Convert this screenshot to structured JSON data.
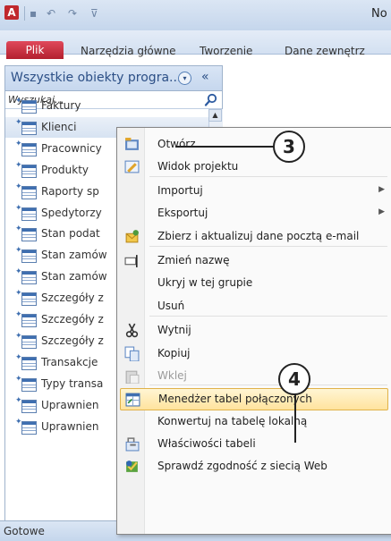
{
  "titlebar": {
    "app_icon": "A",
    "qa_save": "▪",
    "qa_undo": "↶",
    "qa_redo": "↷",
    "qa_more": "⊽",
    "window_title_fragment": "No"
  },
  "ribbon": {
    "tabs": [
      {
        "label": "Plik"
      },
      {
        "label": "Narzędzia główne"
      },
      {
        "label": "Tworzenie"
      },
      {
        "label": "Dane zewnętrz"
      }
    ]
  },
  "nav_pane": {
    "title": "Wszystkie obiekty progra...",
    "chevron": "▾",
    "collapse": "«",
    "search_placeholder": "Wyszukaj...",
    "items": [
      {
        "label": "Faktury"
      },
      {
        "label": "Klienci"
      },
      {
        "label": "Pracownicy"
      },
      {
        "label": "Produkty"
      },
      {
        "label": "Raporty sp"
      },
      {
        "label": "Spedytorzy"
      },
      {
        "label": "Stan podat"
      },
      {
        "label": "Stan zamów"
      },
      {
        "label": "Stan zamów"
      },
      {
        "label": "Szczegóły z"
      },
      {
        "label": "Szczegóły z"
      },
      {
        "label": "Szczegóły z"
      },
      {
        "label": "Transakcje"
      },
      {
        "label": "Typy transa"
      },
      {
        "label": "Uprawnien"
      },
      {
        "label": "Uprawnien"
      }
    ],
    "linked_mark": "✦"
  },
  "context_menu": {
    "items": [
      {
        "label": "Otwórz",
        "icon": "open-icon"
      },
      {
        "label": "Widok projektu",
        "icon": "design-view-icon"
      },
      {
        "label": "Importuj",
        "submenu": true
      },
      {
        "label": "Eksportuj",
        "submenu": true
      },
      {
        "label": "Zbierz i aktualizuj dane pocztą e-mail",
        "icon": "collect-data-icon"
      },
      {
        "label": "Zmień nazwę",
        "icon": "rename-icon"
      },
      {
        "label": "Ukryj w tej grupie"
      },
      {
        "label": "Usuń"
      },
      {
        "label": "Wytnij",
        "icon": "cut-icon"
      },
      {
        "label": "Kopiuj",
        "icon": "copy-icon"
      },
      {
        "label": "Wklej",
        "icon": "paste-icon",
        "disabled": true
      },
      {
        "label": "Menedżer tabel połączonych",
        "icon": "linked-table-manager-icon",
        "highlighted": true
      },
      {
        "label": "Konwertuj na tabelę lokalną"
      },
      {
        "label": "Właściwości tabeli",
        "icon": "properties-icon"
      },
      {
        "label": "Sprawdź zgodność z siecią Web",
        "icon": "web-check-icon"
      }
    ],
    "submenu_arrow": "▶"
  },
  "callouts": [
    {
      "number": "3"
    },
    {
      "number": "4"
    }
  ],
  "statusbar": {
    "text": "Gotowe"
  }
}
